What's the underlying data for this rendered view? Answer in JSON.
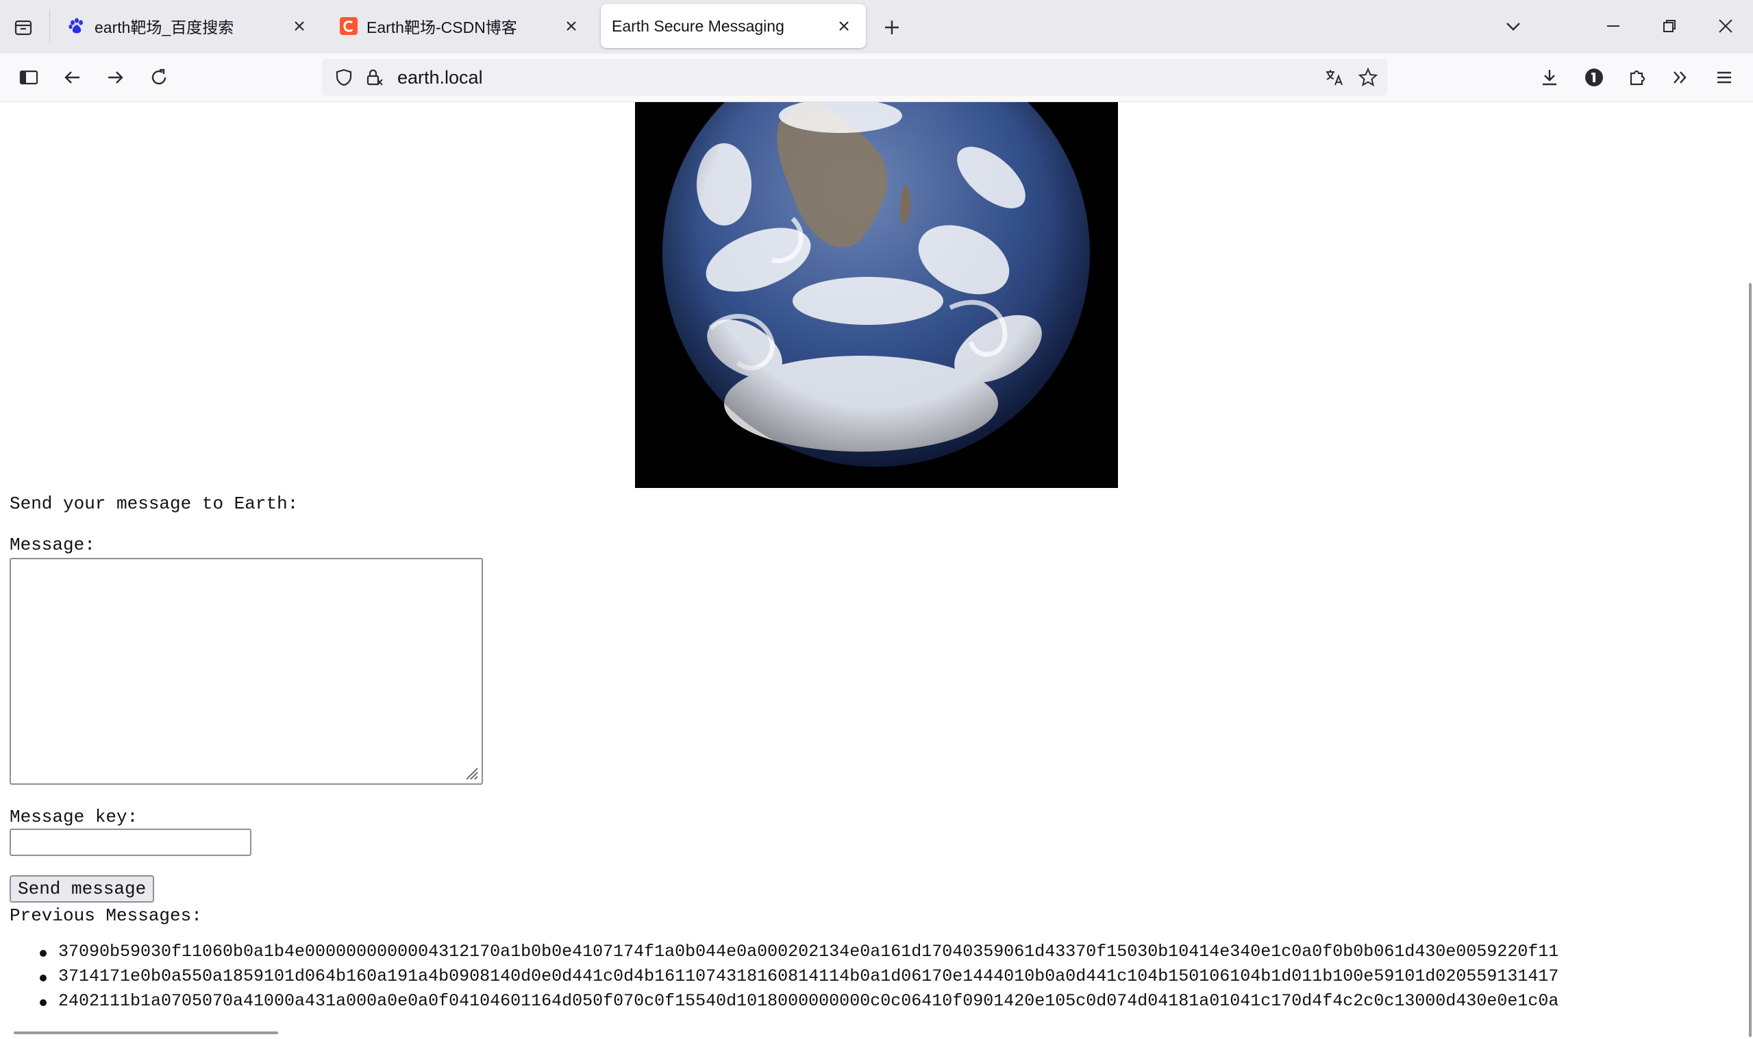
{
  "browser": {
    "tabs": [
      {
        "title": "earth靶场_百度搜索",
        "favicon": "baidu-paw-icon",
        "active": false
      },
      {
        "title": "Earth靶场-CSDN博客",
        "favicon": "csdn-logo-icon",
        "active": false
      },
      {
        "title": "Earth Secure Messaging",
        "favicon": "",
        "active": true
      }
    ],
    "url": "earth.local",
    "colors": {
      "tabbar_bg": "#e9e9ee",
      "navbar_bg": "#f9f9fb",
      "csdn_red": "#fc5531",
      "baidu_blue": "#2932e1"
    }
  },
  "page": {
    "intro": "Send your message to Earth:",
    "message_label": "Message:",
    "message_value": "",
    "key_label": "Message key:",
    "key_value": "",
    "send_label": "Send message",
    "previous_label": "Previous Messages:",
    "messages": [
      "37090b59030f11060b0a1b4e0000000000004312170a1b0b0e4107174f1a0b044e0a000202134e0a161d17040359061d43370f15030b10414e340e1c0a0f0b0b061d430e0059220f11",
      "3714171e0b0a550a1859101d064b160a191a4b0908140d0e0d441c0d4b1611074318160814114b0a1d06170e1444010b0a0d441c104b150106104b1d011b100e59101d020559131417",
      "2402111b1a0705070a41000a431a000a0e0a0f04104601164d050f070c0f15540d1018000000000c0c06410f0901420e105c0d074d04181a01041c170d4f4c2c0c13000d430e0e1c0a"
    ]
  }
}
